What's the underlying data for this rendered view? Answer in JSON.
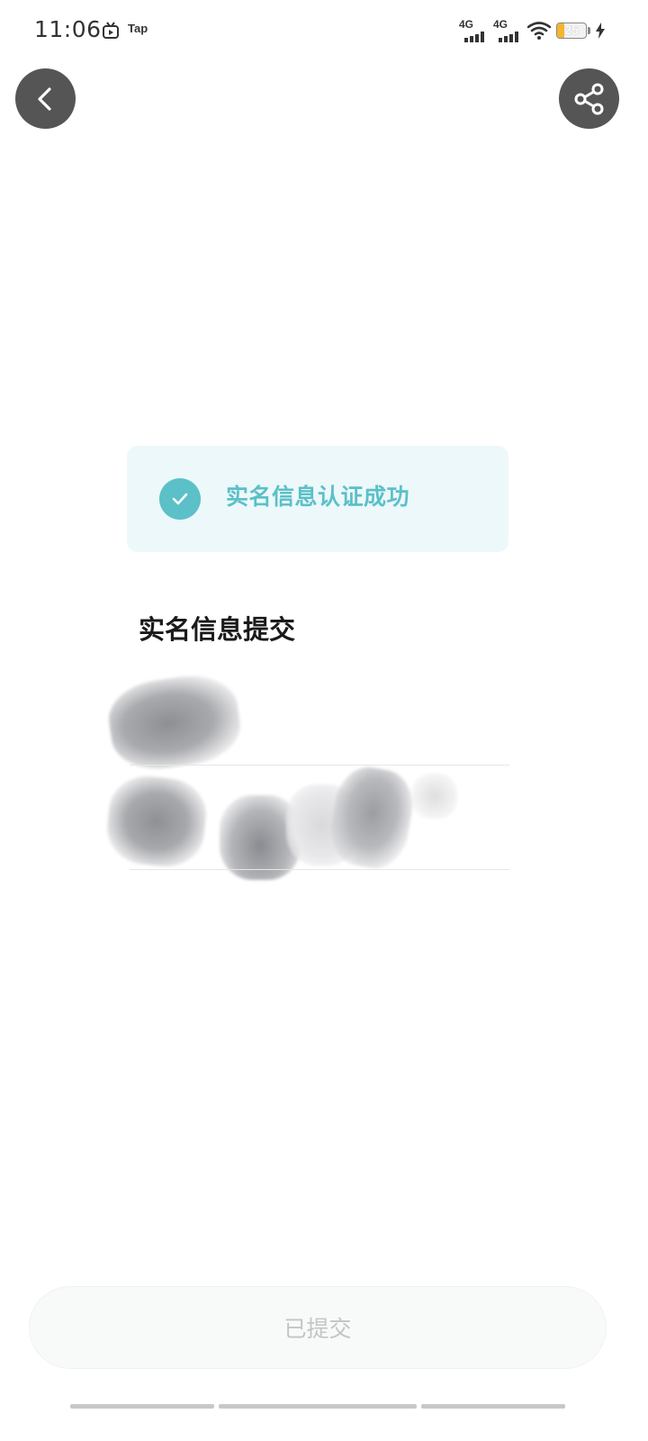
{
  "status_bar": {
    "time": "11:06",
    "app_label": "Tap",
    "signal_1": "4G",
    "signal_2": "4G",
    "battery_level": "25",
    "battery_fraction": 0.25
  },
  "nav": {
    "back_icon": "chevron-left-icon",
    "share_icon": "share-icon"
  },
  "success": {
    "icon": "check-icon",
    "text": "实名信息认证成功",
    "accent_color": "#5bc0c8"
  },
  "submission": {
    "title": "实名信息提交"
  },
  "footer": {
    "button_label": "已提交"
  }
}
